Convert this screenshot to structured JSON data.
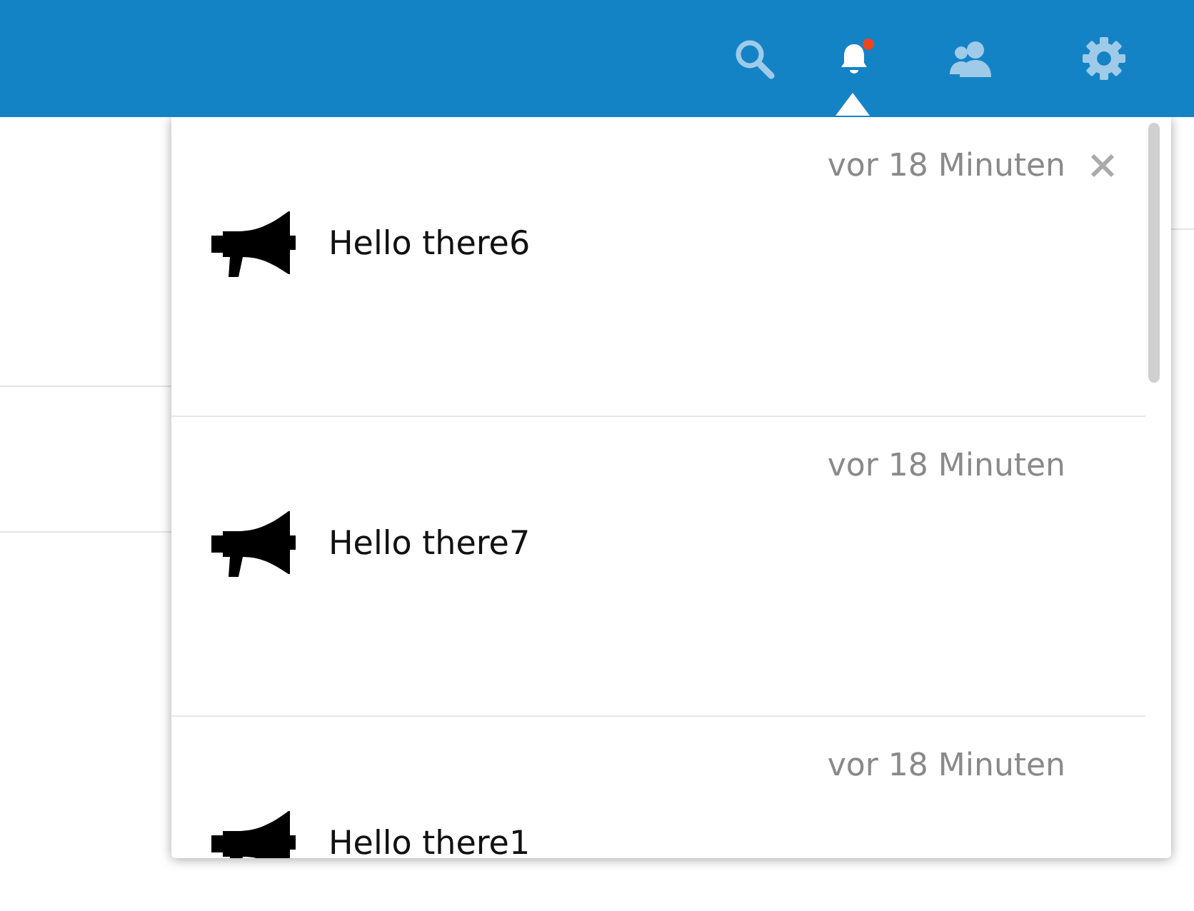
{
  "header": {
    "icons": [
      {
        "kind": "search",
        "selected": false,
        "unread": false
      },
      {
        "kind": "bell",
        "selected": true,
        "unread": true
      },
      {
        "kind": "contacts",
        "selected": false,
        "unread": false
      },
      {
        "kind": "settings",
        "selected": false,
        "unread": false
      }
    ]
  },
  "notifications": [
    {
      "time": "vor 18 Minuten",
      "message": "Hello there6",
      "show_dismiss": true
    },
    {
      "time": "vor 18 Minuten",
      "message": "Hello there7",
      "show_dismiss": false
    },
    {
      "time": "vor 18 Minuten",
      "message": "Hello there1",
      "show_dismiss": false
    }
  ]
}
